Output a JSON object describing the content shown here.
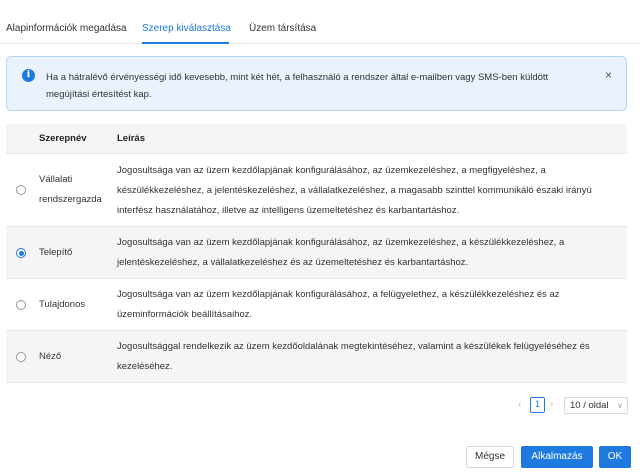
{
  "tabs": [
    {
      "label": "Alapinformációk megadása",
      "active": false
    },
    {
      "label": "Szerep kiválasztása",
      "active": true
    },
    {
      "label": "Üzem társítása",
      "active": false
    }
  ],
  "alert": {
    "icon": "info-icon",
    "icon_glyph": "i",
    "text": "Ha a hátralévő érvényességi idő kevesebb, mint két hét, a felhasználó a rendszer által e-mailben vagy SMS-ben küldött megújítási értesítést kap.",
    "close_glyph": "×"
  },
  "table": {
    "headers": {
      "role": "Szerepnév",
      "description": "Leírás"
    },
    "rows": [
      {
        "role": "Vállalati rendszergazda",
        "description": "Jogosultsága van az üzem kezdőlapjának konfigurálásához, az üzemkezeléshez, a megfigyeléshez, a készülékkezeléshez, a jelentéskezeléshez, a vállalatkezeléshez, a magasabb szinttel kommunikáló északi irányú interfész használatához, illetve az intelligens üzemeltetéshez és karbantartáshoz.",
        "selected": false
      },
      {
        "role": "Telepítő",
        "description": "Jogosultsága van az üzem kezdőlapjának konfigurálásához, az üzemkezeléshez, a készülékkezeléshez, a jelentéskezeléshez, a vállalatkezeléshez és az üzemeltetéshez és karbantartáshoz.",
        "selected": true
      },
      {
        "role": "Tulajdonos",
        "description": "Jogosultsága van az üzem kezdőlapjának konfigurálásához, a felügyelethez, a készülékkezeléshez és az üzeminformációk beállításaihoz.",
        "selected": false
      },
      {
        "role": "Néző",
        "description": "Jogosultsággal rendelkezik az üzem kezdőoldalának megtekintéséhez, valamint a készülékek felügyeléséhez és kezeléséhez.",
        "selected": false
      }
    ]
  },
  "pagination": {
    "prev_glyph": "‹",
    "next_glyph": "›",
    "current_page": "1",
    "page_size": "10 / oldal",
    "chevron_glyph": "∨"
  },
  "buttons": {
    "cancel": "Mégse",
    "apply": "Alkalmazás",
    "ok": "OK"
  },
  "colors": {
    "accent": "#1f7ae0",
    "alert_bg": "#e9f2fd",
    "alert_border": "#b6d2f5"
  }
}
